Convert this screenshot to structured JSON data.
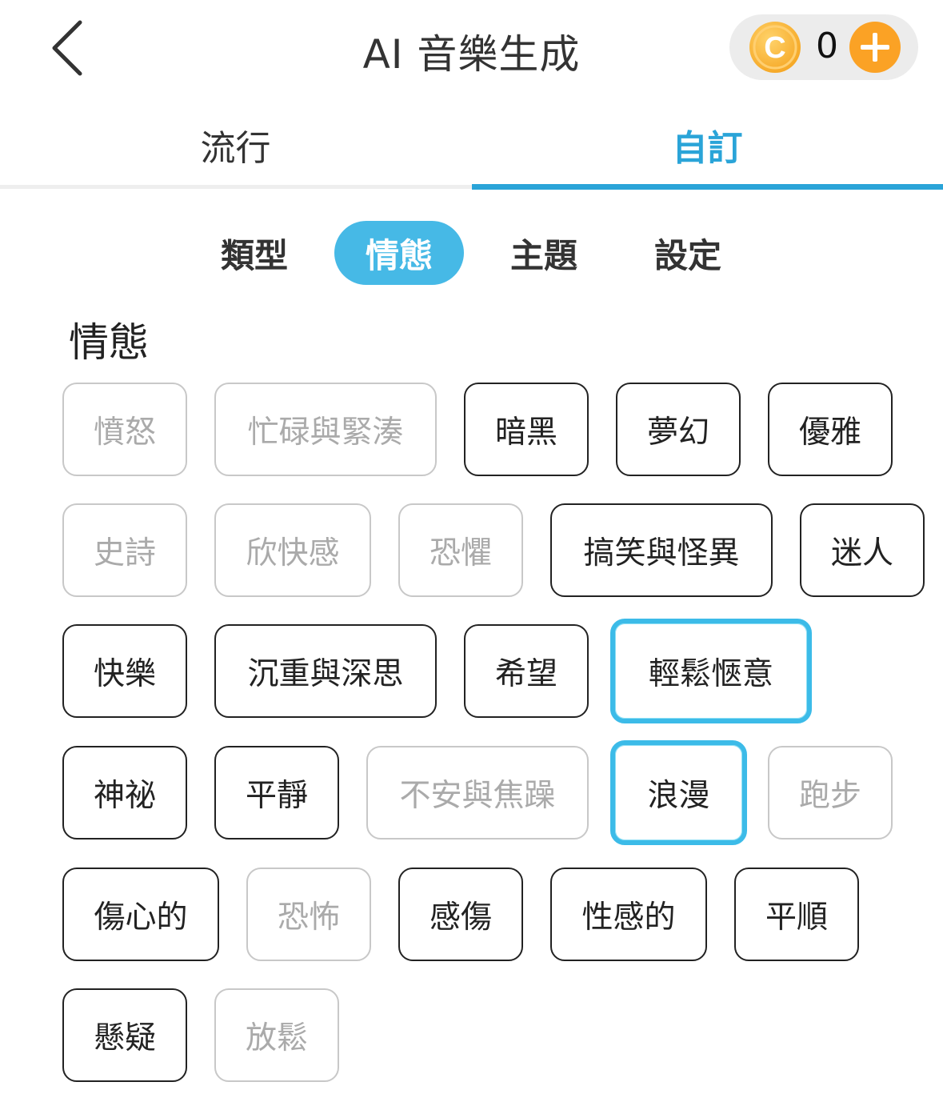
{
  "header": {
    "title": "AI 音樂生成",
    "coin_symbol": "C",
    "coin_count": "0"
  },
  "tabs": [
    {
      "label": "流行",
      "active": false
    },
    {
      "label": "自訂",
      "active": true
    }
  ],
  "subtabs": [
    {
      "label": "類型",
      "active": false
    },
    {
      "label": "情態",
      "active": true
    },
    {
      "label": "主題",
      "active": false
    },
    {
      "label": "設定",
      "active": false
    }
  ],
  "section_title": "情態",
  "moods": [
    {
      "label": "憤怒",
      "state": "disabled"
    },
    {
      "label": "忙碌與緊湊",
      "state": "disabled"
    },
    {
      "label": "暗黑",
      "state": "enabled"
    },
    {
      "label": "夢幻",
      "state": "enabled"
    },
    {
      "label": "優雅",
      "state": "enabled"
    },
    {
      "label": "史詩",
      "state": "disabled"
    },
    {
      "label": "欣快感",
      "state": "disabled"
    },
    {
      "label": "恐懼",
      "state": "disabled"
    },
    {
      "label": "搞笑與怪異",
      "state": "enabled"
    },
    {
      "label": "迷人",
      "state": "enabled"
    },
    {
      "label": "快樂",
      "state": "enabled"
    },
    {
      "label": "沉重與深思",
      "state": "enabled"
    },
    {
      "label": "希望",
      "state": "enabled"
    },
    {
      "label": "輕鬆愜意",
      "state": "selected"
    },
    {
      "label": "神祕",
      "state": "enabled"
    },
    {
      "label": "平靜",
      "state": "enabled"
    },
    {
      "label": "不安與焦躁",
      "state": "disabled"
    },
    {
      "label": "浪漫",
      "state": "selected"
    },
    {
      "label": "跑步",
      "state": "disabled"
    },
    {
      "label": "傷心的",
      "state": "enabled"
    },
    {
      "label": "恐怖",
      "state": "disabled"
    },
    {
      "label": "感傷",
      "state": "enabled"
    },
    {
      "label": "性感的",
      "state": "enabled"
    },
    {
      "label": "平順",
      "state": "enabled"
    },
    {
      "label": "懸疑",
      "state": "enabled"
    },
    {
      "label": "放鬆",
      "state": "disabled"
    }
  ],
  "colors": {
    "accent": "#2aa4d8",
    "subtab_active": "#46b9e6",
    "selected_border": "#3cbbe8",
    "coin": "#fba225"
  }
}
